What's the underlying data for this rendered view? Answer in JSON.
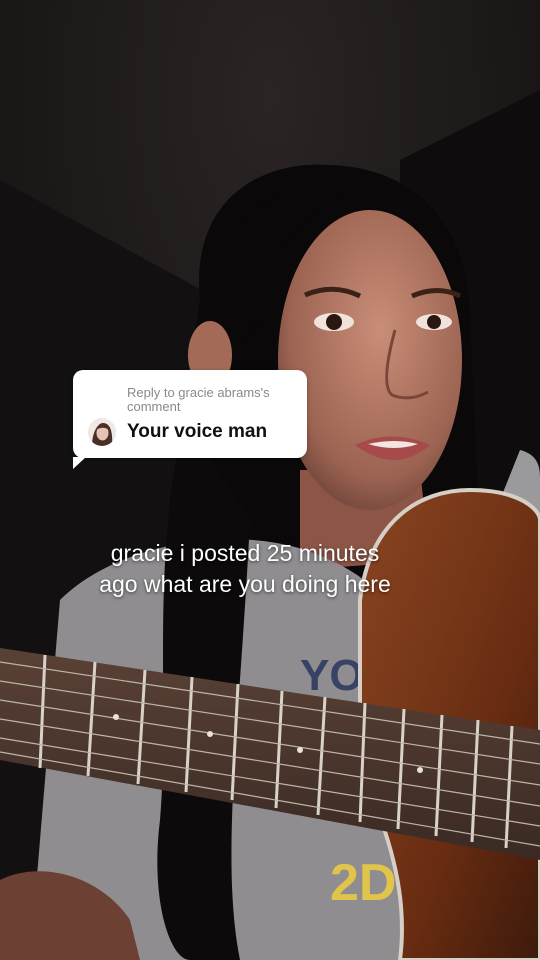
{
  "reply": {
    "header": "Reply to gracie abrams's comment",
    "comment": "Your voice man",
    "avatar_icon": "avatar-photo"
  },
  "caption": {
    "line1": "gracie i posted 25 minutes",
    "line2": "ago what are you doing here"
  },
  "colors": {
    "sticker_bg": "#ffffff",
    "caption_text": "#ffffff",
    "guitar_body": "#7a3a1a"
  }
}
